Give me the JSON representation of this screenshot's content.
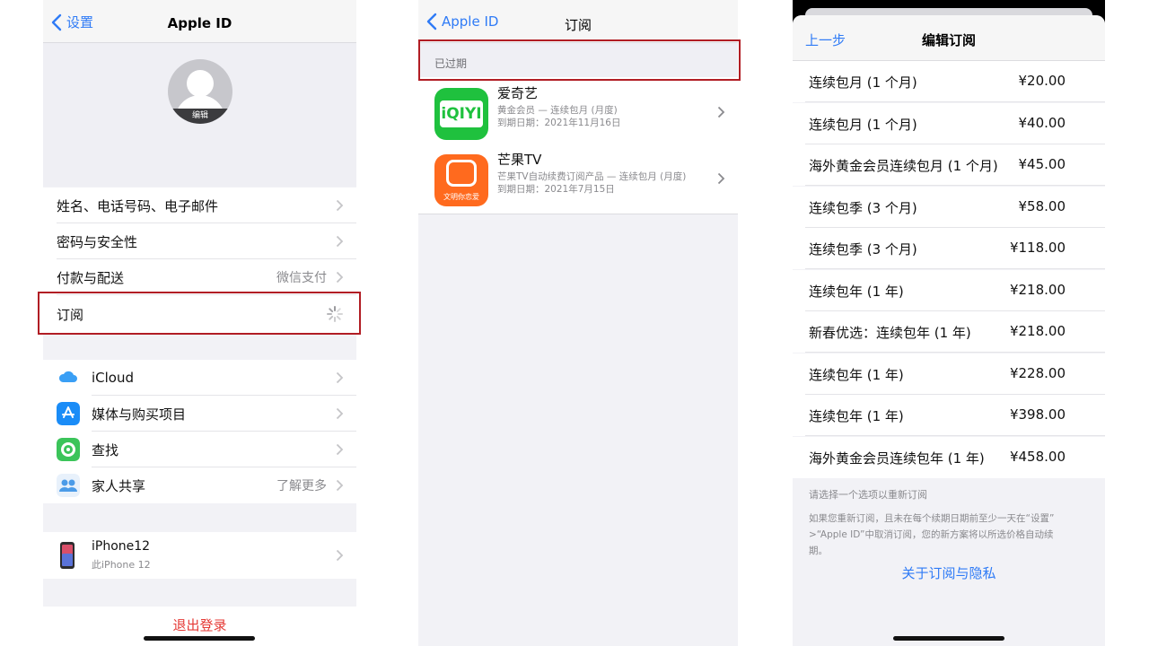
{
  "panel1": {
    "back_label": "设置",
    "title": "Apple ID",
    "avatar_edit": "编辑",
    "rows": [
      {
        "label": "姓名、电话号码、电子邮件",
        "value": ""
      },
      {
        "label": "密码与安全性",
        "value": ""
      },
      {
        "label": "付款与配送",
        "value": "微信支付"
      },
      {
        "label": "订阅",
        "value": ""
      }
    ],
    "services": [
      {
        "label": "iCloud",
        "value": "",
        "icon": "icloud-icon"
      },
      {
        "label": "媒体与购买项目",
        "value": "",
        "icon": "app-store-icon"
      },
      {
        "label": "查找",
        "value": "",
        "icon": "find-my-icon"
      },
      {
        "label": "家人共享",
        "value": "了解更多",
        "icon": "family-sharing-icon"
      }
    ],
    "device": {
      "name": "iPhone12",
      "subtitle": "此iPhone 12"
    },
    "logout": "退出登录"
  },
  "panel2": {
    "back_label": "Apple ID",
    "title": "订阅",
    "section": "已过期",
    "subscriptions": [
      {
        "name": "爱奇艺",
        "line1": "黄金会员 — 连续包月 (月度)",
        "line2": "到期日期：2021年11月16日",
        "icon": "iqiyi-icon",
        "icon_text": "iQIYI"
      },
      {
        "name": "芒果TV",
        "line1": "芒果TV自动续费订阅产品 — 连续包月 (月度)",
        "line2": "到期日期：2021年7月15日",
        "icon": "mango-tv-icon",
        "icon_text": "文明你恋爱"
      }
    ]
  },
  "panel3": {
    "back_label": "上一步",
    "title": "编辑订阅",
    "plans": [
      {
        "name": "连续包月 (1 个月)",
        "price": "¥20.00"
      },
      {
        "name": "连续包月 (1 个月)",
        "price": "¥40.00"
      },
      {
        "name": "海外黄金会员连续包月 (1 个月)",
        "price": "¥45.00"
      },
      {
        "name": "连续包季 (3 个月)",
        "price": "¥58.00"
      },
      {
        "name": "连续包季 (3 个月)",
        "price": "¥118.00"
      },
      {
        "name": "连续包年 (1 年)",
        "price": "¥218.00"
      },
      {
        "name": "新春优选：连续包年 (1 年)",
        "price": "¥218.00"
      },
      {
        "name": "连续包年 (1 年)",
        "price": "¥228.00"
      },
      {
        "name": "连续包年 (1 年)",
        "price": "¥398.00"
      },
      {
        "name": "海外黄金会员连续包年 (1 年)",
        "price": "¥458.00"
      }
    ],
    "hint": "请选择一个选项以重新订阅",
    "note_line1": "如果您重新订阅，且未在每个续期日期前至少一天在“设置”",
    "note_line2": ">“Apple ID”中取消订阅，您的新方案将以所选价格自动续",
    "note_line3": "期。",
    "privacy_link": "关于订阅与隐私"
  },
  "colors": {
    "accent": "#2f7bf6",
    "highlight": "#b11d24",
    "danger": "#e53935"
  }
}
